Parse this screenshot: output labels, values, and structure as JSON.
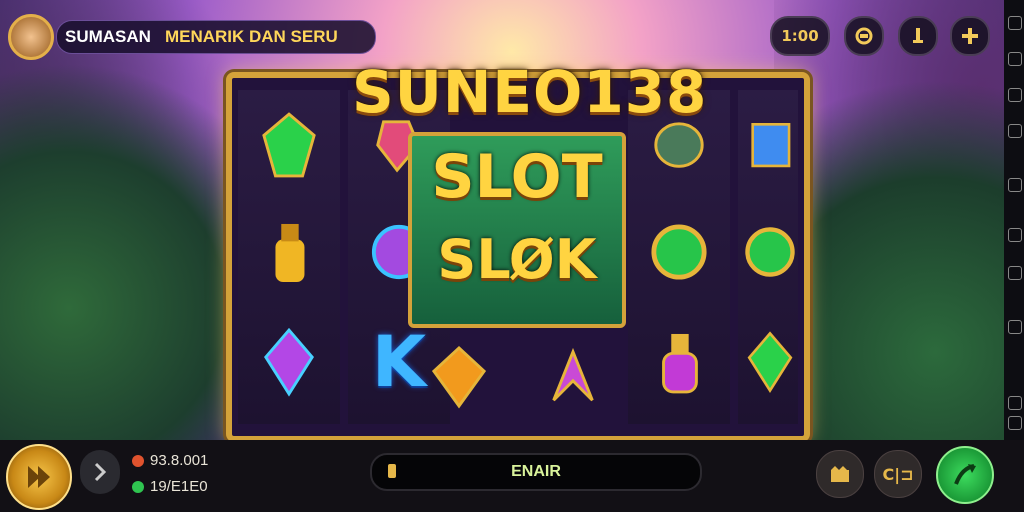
{
  "header": {
    "brand": "SUMASAN",
    "tagline": "MENARIK DAN SERU",
    "bet_value": "1:00"
  },
  "logo": {
    "title": "SUNEO138"
  },
  "center_panel": {
    "line1": "SLOT",
    "line2": "SLØK"
  },
  "reel_symbols": {
    "k_symbol": "K"
  },
  "bottom": {
    "balance": "93.8.001",
    "credit": "19/E1E0",
    "status_label": "ENAIR",
    "button_left_label": "",
    "button_right_label": "C|⊐"
  },
  "colors": {
    "accent_gold": "#ffd441",
    "frame_gold": "#d4a23a",
    "spin_green": "#2fc450"
  },
  "icons": [
    "avatar",
    "refresh-icon",
    "info-icon",
    "plus-icon",
    "back-arrow-icon",
    "coin-icon",
    "shield-check-icon",
    "castle-icon",
    "spin-arrow-icon"
  ]
}
